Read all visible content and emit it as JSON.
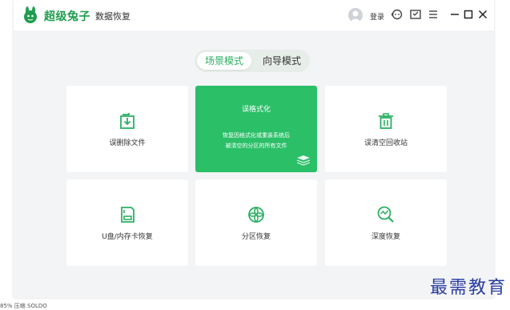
{
  "app": {
    "brand": "超级兔子",
    "subbrand": "数据恢复",
    "login": "登录"
  },
  "tabs": [
    {
      "label": "场景模式"
    },
    {
      "label": "向导模式"
    }
  ],
  "cards": [
    {
      "label": "误删除文件",
      "icon": "file-restore-icon"
    },
    {
      "label": "误格式化",
      "desc1": "恢复因格式化或重装系统后",
      "desc2": "被清空的分区的所有文件",
      "icon": "layers-icon"
    },
    {
      "label": "误清空回收站",
      "icon": "trash-icon"
    },
    {
      "label": "U盘/内存卡恢复",
      "icon": "sd-card-icon"
    },
    {
      "label": "分区恢复",
      "icon": "partition-icon"
    },
    {
      "label": "深度恢复",
      "icon": "search-chart-icon"
    }
  ],
  "watermark": "最需教育",
  "status_text": "85% 压缩 SOLDO",
  "colors": {
    "accent": "#2bbf68",
    "brand": "#1f9d4e"
  }
}
